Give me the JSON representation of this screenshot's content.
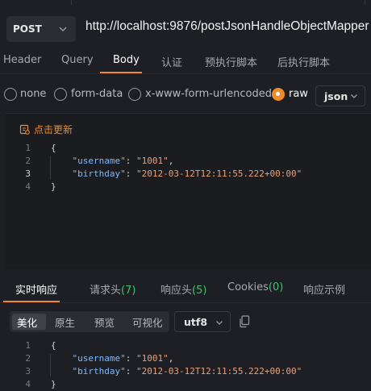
{
  "request": {
    "method": "POST",
    "url": "http://localhost:9876/postJsonHandleObjectMapper",
    "tabs": [
      "Header",
      "Query",
      "Body",
      "认证",
      "预执行脚本",
      "后执行脚本"
    ],
    "active_tab": "Body"
  },
  "body_types": {
    "options": [
      "none",
      "form-data",
      "x-www-form-urlencoded",
      "raw"
    ],
    "selected": "raw",
    "format": "json"
  },
  "editor": {
    "update_label": "点击更新",
    "line_numbers": [
      "1",
      "2",
      "3",
      "4"
    ],
    "current_line": "3",
    "lines": [
      {
        "parts": [
          {
            "t": "{",
            "c": "p"
          }
        ]
      },
      {
        "parts": [
          {
            "t": "    ",
            "c": "p"
          },
          {
            "t": "\"username\"",
            "c": "k"
          },
          {
            "t": ": ",
            "c": "p"
          },
          {
            "t": "\"1001\"",
            "c": "s"
          },
          {
            "t": ",",
            "c": "p"
          }
        ]
      },
      {
        "parts": [
          {
            "t": "    ",
            "c": "p"
          },
          {
            "t": "\"birthday\"",
            "c": "k"
          },
          {
            "t": ": ",
            "c": "p"
          },
          {
            "t": "\"2012-03-12T12:11:55.222+00:00\"",
            "c": "s"
          }
        ]
      },
      {
        "parts": [
          {
            "t": "}",
            "c": "p"
          }
        ]
      }
    ]
  },
  "response": {
    "tabs": [
      {
        "label": "实时响应",
        "count": ""
      },
      {
        "label": "请求头",
        "count": "(7)"
      },
      {
        "label": "响应头",
        "count": "(5)"
      },
      {
        "label": "Cookies",
        "count": "(0)"
      },
      {
        "label": "响应示例",
        "count": ""
      }
    ],
    "active_tab": "实时响应",
    "view_modes": [
      "美化",
      "原生",
      "预览",
      "可视化"
    ],
    "active_view": "美化",
    "encoding": "utf8",
    "line_numbers": [
      "1",
      "2",
      "3",
      "4"
    ],
    "lines": [
      {
        "parts": [
          {
            "t": "{",
            "c": "p"
          }
        ]
      },
      {
        "parts": [
          {
            "t": "    ",
            "c": "p"
          },
          {
            "t": "\"username\"",
            "c": "k"
          },
          {
            "t": ": ",
            "c": "p"
          },
          {
            "t": "\"1001\"",
            "c": "s"
          },
          {
            "t": ",",
            "c": "p"
          }
        ]
      },
      {
        "parts": [
          {
            "t": "    ",
            "c": "p"
          },
          {
            "t": "\"birthday\"",
            "c": "k"
          },
          {
            "t": ": ",
            "c": "p"
          },
          {
            "t": "\"2012-03-12T12:11:55.222+00:00\"",
            "c": "s"
          }
        ]
      },
      {
        "parts": [
          {
            "t": "}",
            "c": "p"
          }
        ]
      }
    ]
  },
  "icons": {
    "method_dropdown": "chevron-down-icon",
    "format_dropdown": "chevron-down-icon",
    "encoding_dropdown": "chevron-down-icon",
    "update": "refresh-doc-icon",
    "copy": "copy-icon"
  },
  "colors": {
    "accent": "#f18a2c",
    "count": "#3fc46a",
    "json_key": "#7fb8ff",
    "json_string": "#e8a27a",
    "background": "#1e1f24"
  }
}
